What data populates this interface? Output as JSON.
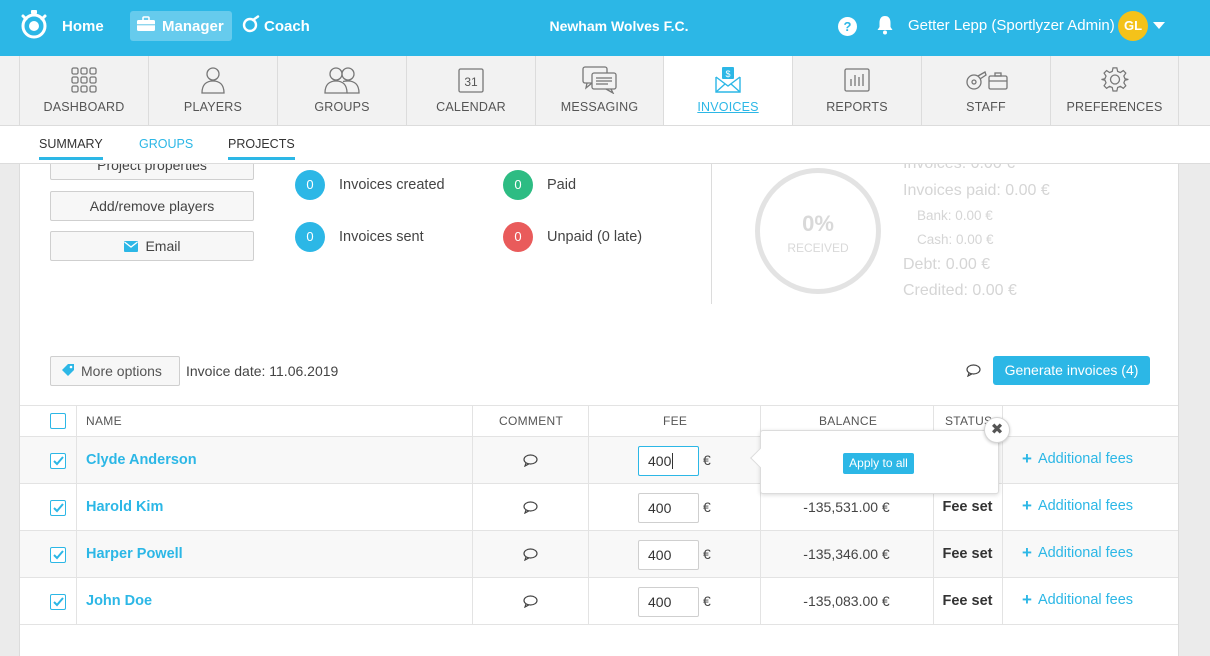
{
  "topbar": {
    "home_label": "Home",
    "manager_label": "Manager",
    "coach_label": "Coach",
    "club_name": "Newham Wolves F.C.",
    "help_label": "?",
    "user_name": "Getter Lepp (Sportlyzer Admin)",
    "avatar_initials": "GL",
    "avatar_color": "#f4c21a",
    "brand_color": "#2cb7e6"
  },
  "modules": [
    {
      "label": "DASHBOARD",
      "icon": "grid-icon"
    },
    {
      "label": "PLAYERS",
      "icon": "player-icon"
    },
    {
      "label": "GROUPS",
      "icon": "group-icon"
    },
    {
      "label": "CALENDAR",
      "icon": "calendar-icon",
      "icon_text": "31"
    },
    {
      "label": "MESSAGING",
      "icon": "messages-icon"
    },
    {
      "label": "INVOICES",
      "icon": "invoice-envelope-icon",
      "active": true
    },
    {
      "label": "REPORTS",
      "icon": "bar-chart-icon"
    },
    {
      "label": "STAFF",
      "icon": "whistle-briefcase-icon"
    },
    {
      "label": "PREFERENCES",
      "icon": "gear-icon"
    }
  ],
  "subnav": {
    "summary": "SUMMARY",
    "groups": "GROUPS",
    "projects": "PROJECTS"
  },
  "actions": {
    "project_properties": "Project properties",
    "add_remove_players": "Add/remove players",
    "email": "Email"
  },
  "stats": {
    "invoices_created": {
      "count": "0",
      "label": "Invoices created",
      "color": "#2cb7e6"
    },
    "invoices_sent": {
      "count": "0",
      "label": "Invoices sent",
      "color": "#2cb7e6"
    },
    "paid": {
      "count": "0",
      "label": "Paid",
      "color": "#2dbc83"
    },
    "unpaid": {
      "count": "0",
      "label": "Unpaid (0 late)",
      "color": "#e95b5b"
    }
  },
  "summary": {
    "percent": "0%",
    "received_label": "RECEIVED",
    "invoices": "Invoices: 0.00 €",
    "invoices_paid": "Invoices paid: 0.00 €",
    "bank": "Bank: 0.00 €",
    "cash": "Cash: 0.00 €",
    "debt": "Debt: 0.00 €",
    "credited": "Credited: 0.00 €"
  },
  "toolbar": {
    "more_options": "More options",
    "invoice_date": "Invoice date: 11.06.2019",
    "generate": "Generate invoices (4)"
  },
  "table": {
    "headers": {
      "name": "NAME",
      "comment": "COMMENT",
      "fee": "FEE",
      "balance": "BALANCE",
      "status": "STATUS"
    },
    "currency": "€",
    "additional_fees_label": "Additional fees",
    "rows": [
      {
        "name": "Clyde Anderson",
        "fee": "400",
        "balance": "",
        "status": "",
        "checked": true
      },
      {
        "name": "Harold Kim",
        "fee": "400",
        "balance": "-135,531.00 €",
        "status": "Fee set",
        "checked": true
      },
      {
        "name": "Harper Powell",
        "fee": "400",
        "balance": "-135,346.00 €",
        "status": "Fee set",
        "checked": true
      },
      {
        "name": "John Doe",
        "fee": "400",
        "balance": "-135,083.00 €",
        "status": "Fee set",
        "checked": true
      }
    ]
  },
  "popover": {
    "apply_label": "Apply to all",
    "close_label": "✖"
  }
}
